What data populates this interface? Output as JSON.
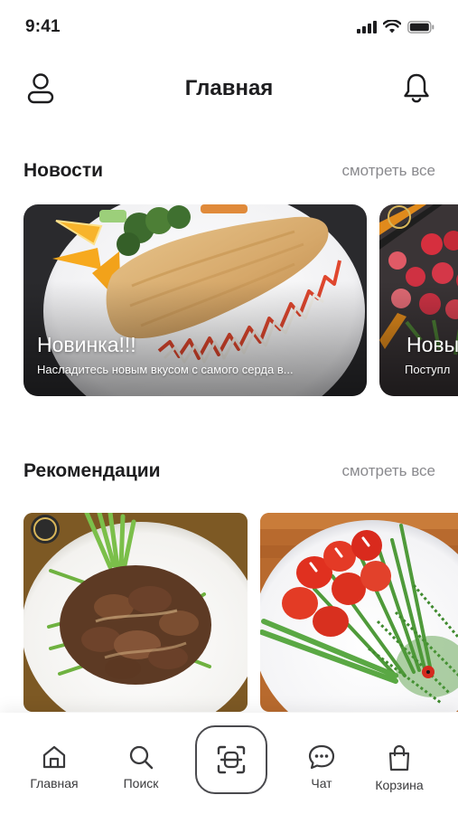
{
  "status_bar": {
    "time": "9:41"
  },
  "header": {
    "title": "Главная"
  },
  "news": {
    "title": "Новости",
    "see_all": "смотреть все",
    "cards": [
      {
        "title": "Новинка!!!",
        "subtitle": "Насладитесь новым вкусом с самого серда в..."
      },
      {
        "title": "Новы",
        "subtitle": "Поступл"
      }
    ]
  },
  "recommendations": {
    "title": "Рекомендации",
    "see_all": "смотреть все"
  },
  "nav": {
    "home": "Главная",
    "search": "Поиск",
    "chat": "Чат",
    "cart": "Корзина"
  },
  "colors": {
    "text": "#1d1d1f",
    "muted": "#8a8a8e",
    "accent": "#4a4a4e"
  },
  "icons": {
    "profile": "user-icon",
    "notifications": "bell-icon",
    "home": "home-icon",
    "search": "search-icon",
    "scan": "scan-icon",
    "chat": "chat-bubble-icon",
    "cart": "shopping-bag-icon"
  }
}
